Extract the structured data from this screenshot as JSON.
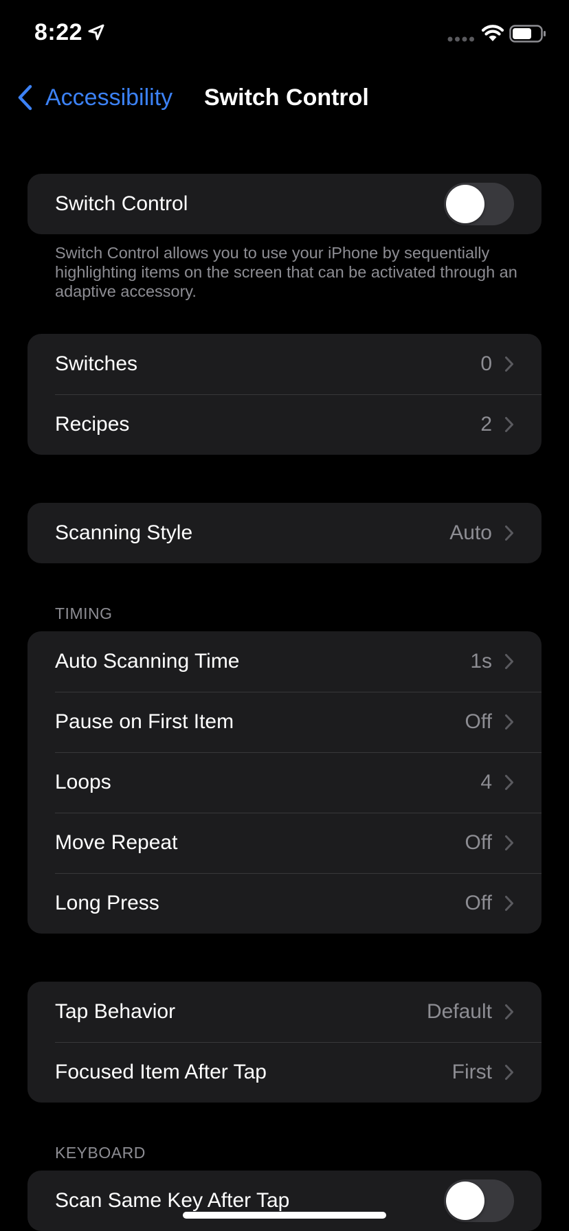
{
  "status_bar": {
    "time": "8:22",
    "icons": [
      "location-arrow-icon",
      "cellular-signal-icon",
      "wifi-icon",
      "battery-icon"
    ]
  },
  "nav": {
    "back_label": "Accessibility",
    "title": "Switch Control",
    "accent_color": "#3c82f6"
  },
  "main_toggle": {
    "label": "Switch Control",
    "on": false
  },
  "main_footer": "Switch Control allows you to use your iPhone by sequentially highlighting items on the screen that can be activated through an adaptive accessory.",
  "group_switches": [
    {
      "label": "Switches",
      "value": "0"
    },
    {
      "label": "Recipes",
      "value": "2"
    }
  ],
  "group_scanning": [
    {
      "label": "Scanning Style",
      "value": "Auto"
    }
  ],
  "timing": {
    "header": "TIMING",
    "rows": [
      {
        "label": "Auto Scanning Time",
        "value": "1s"
      },
      {
        "label": "Pause on First Item",
        "value": "Off"
      },
      {
        "label": "Loops",
        "value": "4"
      },
      {
        "label": "Move Repeat",
        "value": "Off"
      },
      {
        "label": "Long Press",
        "value": "Off"
      }
    ]
  },
  "group_tap": [
    {
      "label": "Tap Behavior",
      "value": "Default"
    },
    {
      "label": "Focused Item After Tap",
      "value": "First"
    }
  ],
  "keyboard": {
    "header": "KEYBOARD",
    "rows": [
      {
        "label": "Scan Same Key After Tap",
        "on": false
      }
    ]
  }
}
